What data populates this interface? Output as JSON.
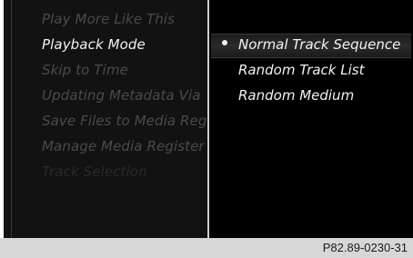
{
  "left_menu": {
    "items": [
      {
        "label": "Play More Like This",
        "state": "disabled"
      },
      {
        "label": "Playback Mode",
        "state": "active"
      },
      {
        "label": "Skip to Time",
        "state": "disabled"
      },
      {
        "label": "Updating Metadata Via",
        "state": "disabled"
      },
      {
        "label": "Save Files to Media Reg",
        "state": "disabled"
      },
      {
        "label": "Manage Media Register",
        "state": "disabled"
      },
      {
        "label": "Track Selection",
        "state": "faint"
      }
    ]
  },
  "playback_mode_options": {
    "items": [
      {
        "label": "Normal Track Sequence",
        "selected": true
      },
      {
        "label": "Random Track List",
        "selected": false
      },
      {
        "label": "Random Medium",
        "selected": false
      }
    ]
  },
  "footer": {
    "code": "P82.89-0230-31"
  },
  "colors": {
    "active_text": "#f2f2f2",
    "disabled_text": "#4a4a4a",
    "background": "#000000",
    "footer_bg": "#d7d7d7"
  }
}
